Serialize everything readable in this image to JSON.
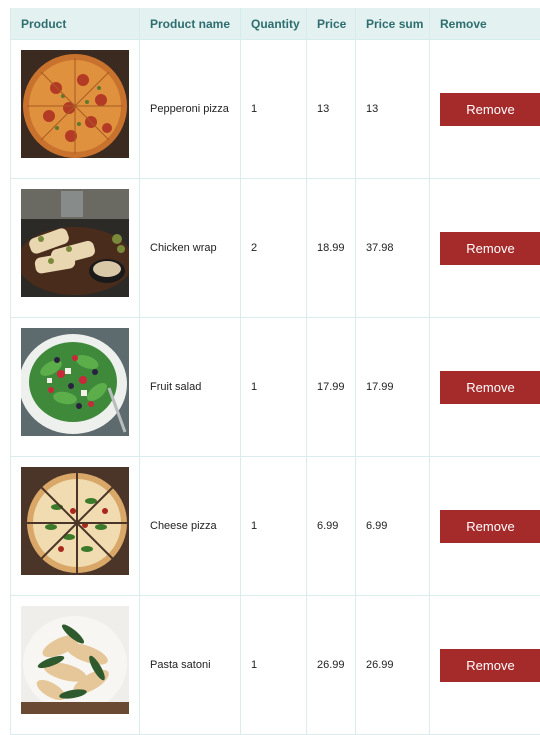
{
  "headers": {
    "product": "Product",
    "name": "Product name",
    "quantity": "Quantity",
    "price": "Price",
    "sum": "Price sum",
    "remove": "Remove"
  },
  "items": [
    {
      "name": "Pepperoni pizza",
      "quantity": "1",
      "price": "13",
      "sum": "13",
      "remove_label": "Remove",
      "image": "pepperoni-pizza-photo"
    },
    {
      "name": "Chicken wrap",
      "quantity": "2",
      "price": "18.99",
      "sum": "37.98",
      "remove_label": "Remove",
      "image": "chicken-wrap-photo"
    },
    {
      "name": "Fruit salad",
      "quantity": "1",
      "price": "17.99",
      "sum": "17.99",
      "remove_label": "Remove",
      "image": "fruit-salad-photo"
    },
    {
      "name": "Cheese pizza",
      "quantity": "1",
      "price": "6.99",
      "sum": "6.99",
      "remove_label": "Remove",
      "image": "cheese-pizza-photo"
    },
    {
      "name": "Pasta satoni",
      "quantity": "1",
      "price": "26.99",
      "sum": "26.99",
      "remove_label": "Remove",
      "image": "pasta-photo"
    }
  ],
  "colors": {
    "header_bg": "#e3f1f1",
    "header_text": "#2e6e6e",
    "remove_button": "#a52a2a"
  }
}
